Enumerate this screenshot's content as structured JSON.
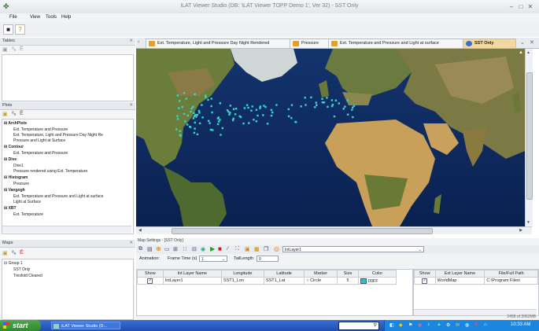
{
  "window": {
    "title": "iLAT Viewer Studio (DB: 'iLAT Viewer TOPP Demo 1', Ver 32) - SST Only"
  },
  "menu": [
    "File",
    "View",
    "Tools",
    "Help"
  ],
  "tables_panel": {
    "title": "Tables"
  },
  "plots_panel": {
    "title": "Plots",
    "groups": [
      {
        "name": "ArchPlots",
        "items": [
          "Ext. Temperature and Pressure",
          "Ext. Temperature, Light and Pressure Day Night Re",
          "Pressure and Light at Surface"
        ]
      },
      {
        "name": "Contour",
        "items": [
          "Ext. Temperature and Pressure"
        ]
      },
      {
        "name": "Dive",
        "items": [
          "Dive1",
          "Pressure rendered using Ext. Temperature"
        ]
      },
      {
        "name": "Histogram",
        "items": [
          "Pressure"
        ]
      },
      {
        "name": "Vangogh",
        "items": [
          "Ext. Temperature and Pressure and Light at surface",
          "Light at Surface"
        ]
      },
      {
        "name": "XBT",
        "items": [
          "Ext. Temperature"
        ]
      }
    ]
  },
  "maps_panel": {
    "title": "Maps",
    "group": "Group 1",
    "items": [
      "SST Only",
      "Tresfold Cleared"
    ]
  },
  "tabs": [
    {
      "label": "Ext. Temperature, Light and Pressure Day Night Rendered"
    },
    {
      "label": "Pressure"
    },
    {
      "label": "Ext. Temperature and Pressure and Light at surface"
    },
    {
      "label": "SST Only"
    }
  ],
  "map_settings": {
    "title": "Map Settings - [SST Only]",
    "layer_name": "IntLayer1",
    "animation_label": "Animation:",
    "frame_time_label": "Frame Time (s)",
    "frame_time_value": "1",
    "tail_length_label": "TailLength",
    "tail_length_value": "0",
    "layer_columns": [
      "Show",
      "Int Layer Name",
      "Longitude",
      "Latitude",
      "Marker",
      "Size",
      "Color"
    ],
    "layer_rows": [
      {
        "name": "IntLayer1",
        "longitude": "SST1_Lon",
        "latitude": "SST1_Lat",
        "marker": "Circle",
        "size": "5",
        "color": "00FF"
      }
    ],
    "ext_columns": [
      "Show",
      "Ext Layer Name",
      "File/Full Path"
    ],
    "ext_rows": [
      {
        "name": "WorldMap",
        "path": "C:\\Program Files\\"
      }
    ]
  },
  "status": {
    "text": "2458 of 3962MB"
  },
  "taskbar": {
    "start": "start",
    "app": "iLAT Viewer Studio (D...",
    "clock": "10:33 AM"
  },
  "colors": {
    "point": "#3ad6c9",
    "ocean": "#0d2a5e",
    "tab_active": "#f0d8a0",
    "marker_color": "#19c8e0"
  }
}
